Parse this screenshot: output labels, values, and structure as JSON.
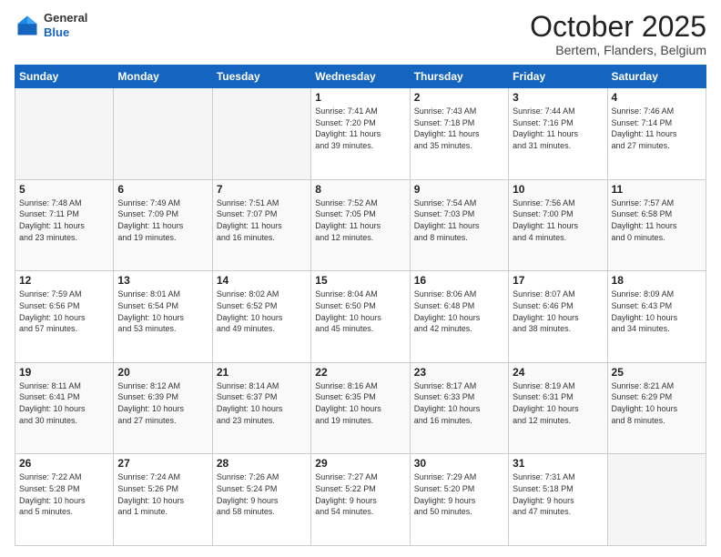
{
  "header": {
    "logo": {
      "line1": "General",
      "line2": "Blue"
    },
    "title": "October 2025",
    "subtitle": "Bertem, Flanders, Belgium"
  },
  "weekdays": [
    "Sunday",
    "Monday",
    "Tuesday",
    "Wednesday",
    "Thursday",
    "Friday",
    "Saturday"
  ],
  "weeks": [
    [
      {
        "day": "",
        "info": ""
      },
      {
        "day": "",
        "info": ""
      },
      {
        "day": "",
        "info": ""
      },
      {
        "day": "1",
        "info": "Sunrise: 7:41 AM\nSunset: 7:20 PM\nDaylight: 11 hours\nand 39 minutes."
      },
      {
        "day": "2",
        "info": "Sunrise: 7:43 AM\nSunset: 7:18 PM\nDaylight: 11 hours\nand 35 minutes."
      },
      {
        "day": "3",
        "info": "Sunrise: 7:44 AM\nSunset: 7:16 PM\nDaylight: 11 hours\nand 31 minutes."
      },
      {
        "day": "4",
        "info": "Sunrise: 7:46 AM\nSunset: 7:14 PM\nDaylight: 11 hours\nand 27 minutes."
      }
    ],
    [
      {
        "day": "5",
        "info": "Sunrise: 7:48 AM\nSunset: 7:11 PM\nDaylight: 11 hours\nand 23 minutes."
      },
      {
        "day": "6",
        "info": "Sunrise: 7:49 AM\nSunset: 7:09 PM\nDaylight: 11 hours\nand 19 minutes."
      },
      {
        "day": "7",
        "info": "Sunrise: 7:51 AM\nSunset: 7:07 PM\nDaylight: 11 hours\nand 16 minutes."
      },
      {
        "day": "8",
        "info": "Sunrise: 7:52 AM\nSunset: 7:05 PM\nDaylight: 11 hours\nand 12 minutes."
      },
      {
        "day": "9",
        "info": "Sunrise: 7:54 AM\nSunset: 7:03 PM\nDaylight: 11 hours\nand 8 minutes."
      },
      {
        "day": "10",
        "info": "Sunrise: 7:56 AM\nSunset: 7:00 PM\nDaylight: 11 hours\nand 4 minutes."
      },
      {
        "day": "11",
        "info": "Sunrise: 7:57 AM\nSunset: 6:58 PM\nDaylight: 11 hours\nand 0 minutes."
      }
    ],
    [
      {
        "day": "12",
        "info": "Sunrise: 7:59 AM\nSunset: 6:56 PM\nDaylight: 10 hours\nand 57 minutes."
      },
      {
        "day": "13",
        "info": "Sunrise: 8:01 AM\nSunset: 6:54 PM\nDaylight: 10 hours\nand 53 minutes."
      },
      {
        "day": "14",
        "info": "Sunrise: 8:02 AM\nSunset: 6:52 PM\nDaylight: 10 hours\nand 49 minutes."
      },
      {
        "day": "15",
        "info": "Sunrise: 8:04 AM\nSunset: 6:50 PM\nDaylight: 10 hours\nand 45 minutes."
      },
      {
        "day": "16",
        "info": "Sunrise: 8:06 AM\nSunset: 6:48 PM\nDaylight: 10 hours\nand 42 minutes."
      },
      {
        "day": "17",
        "info": "Sunrise: 8:07 AM\nSunset: 6:46 PM\nDaylight: 10 hours\nand 38 minutes."
      },
      {
        "day": "18",
        "info": "Sunrise: 8:09 AM\nSunset: 6:43 PM\nDaylight: 10 hours\nand 34 minutes."
      }
    ],
    [
      {
        "day": "19",
        "info": "Sunrise: 8:11 AM\nSunset: 6:41 PM\nDaylight: 10 hours\nand 30 minutes."
      },
      {
        "day": "20",
        "info": "Sunrise: 8:12 AM\nSunset: 6:39 PM\nDaylight: 10 hours\nand 27 minutes."
      },
      {
        "day": "21",
        "info": "Sunrise: 8:14 AM\nSunset: 6:37 PM\nDaylight: 10 hours\nand 23 minutes."
      },
      {
        "day": "22",
        "info": "Sunrise: 8:16 AM\nSunset: 6:35 PM\nDaylight: 10 hours\nand 19 minutes."
      },
      {
        "day": "23",
        "info": "Sunrise: 8:17 AM\nSunset: 6:33 PM\nDaylight: 10 hours\nand 16 minutes."
      },
      {
        "day": "24",
        "info": "Sunrise: 8:19 AM\nSunset: 6:31 PM\nDaylight: 10 hours\nand 12 minutes."
      },
      {
        "day": "25",
        "info": "Sunrise: 8:21 AM\nSunset: 6:29 PM\nDaylight: 10 hours\nand 8 minutes."
      }
    ],
    [
      {
        "day": "26",
        "info": "Sunrise: 7:22 AM\nSunset: 5:28 PM\nDaylight: 10 hours\nand 5 minutes."
      },
      {
        "day": "27",
        "info": "Sunrise: 7:24 AM\nSunset: 5:26 PM\nDaylight: 10 hours\nand 1 minute."
      },
      {
        "day": "28",
        "info": "Sunrise: 7:26 AM\nSunset: 5:24 PM\nDaylight: 9 hours\nand 58 minutes."
      },
      {
        "day": "29",
        "info": "Sunrise: 7:27 AM\nSunset: 5:22 PM\nDaylight: 9 hours\nand 54 minutes."
      },
      {
        "day": "30",
        "info": "Sunrise: 7:29 AM\nSunset: 5:20 PM\nDaylight: 9 hours\nand 50 minutes."
      },
      {
        "day": "31",
        "info": "Sunrise: 7:31 AM\nSunset: 5:18 PM\nDaylight: 9 hours\nand 47 minutes."
      },
      {
        "day": "",
        "info": ""
      }
    ]
  ]
}
